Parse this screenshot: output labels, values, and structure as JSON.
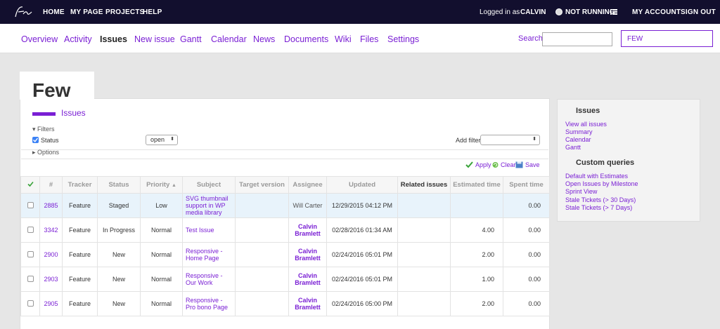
{
  "topbar": {
    "nav": [
      "HOME",
      "MY PAGE",
      "PROJECTS",
      "HELP"
    ],
    "logged_in_as": "Logged in as",
    "user": "CALVIN",
    "timer_status": "NOT RUNNING",
    "my_account": "MY ACCOUNT",
    "sign_out": "SIGN OUT"
  },
  "menu": {
    "tabs": [
      "Overview",
      "Activity",
      "Issues",
      "New issue",
      "Gantt",
      "Calendar",
      "News",
      "Documents",
      "Wiki",
      "Files",
      "Settings"
    ],
    "active_tab": "Issues",
    "search_label": "Search",
    "search_value": "",
    "project_jump": "FEW"
  },
  "page": {
    "project_title": "Few",
    "section": "Issues"
  },
  "filters": {
    "filters_label": "Filters",
    "status_label": "Status",
    "status_operator": "open",
    "add_filter_label": "Add filter",
    "add_filter_value": "",
    "options_label": "Options",
    "apply": "Apply",
    "clear": "Clear",
    "save": "Save"
  },
  "table": {
    "columns": [
      "#",
      "Tracker",
      "Status",
      "Priority",
      "Subject",
      "Target version",
      "Assignee",
      "Updated",
      "Related issues",
      "Estimated time",
      "Spent time"
    ],
    "sort_indicator": "▲",
    "rows": [
      {
        "id": "2885",
        "tracker": "Feature",
        "status": "Staged",
        "priority": "Low",
        "subject": "SVG thumbnail support in WP media library",
        "target_version": "",
        "assignee": "Will Carter",
        "updated": "12/29/2015 04:12 PM",
        "related": "",
        "estimated": "",
        "spent": "0.00"
      },
      {
        "id": "3342",
        "tracker": "Feature",
        "status": "In Progress",
        "priority": "Normal",
        "subject": "Test Issue",
        "target_version": "",
        "assignee": "Calvin Bramlett",
        "updated": "02/28/2016 01:34 AM",
        "related": "",
        "estimated": "4.00",
        "spent": "0.00"
      },
      {
        "id": "2900",
        "tracker": "Feature",
        "status": "New",
        "priority": "Normal",
        "subject": "Responsive - Home Page",
        "target_version": "",
        "assignee": "Calvin Bramlett",
        "updated": "02/24/2016 05:01 PM",
        "related": "",
        "estimated": "2.00",
        "spent": "0.00"
      },
      {
        "id": "2903",
        "tracker": "Feature",
        "status": "New",
        "priority": "Normal",
        "subject": "Responsive - Our Work",
        "target_version": "",
        "assignee": "Calvin Bramlett",
        "updated": "02/24/2016 05:01 PM",
        "related": "",
        "estimated": "1.00",
        "spent": "0.00"
      },
      {
        "id": "2905",
        "tracker": "Feature",
        "status": "New",
        "priority": "Normal",
        "subject": "Responsive - Pro bono Page",
        "target_version": "",
        "assignee": "Calvin Bramlett",
        "updated": "02/24/2016 05:00 PM",
        "related": "",
        "estimated": "2.00",
        "spent": "0.00"
      }
    ]
  },
  "sidebar": {
    "issues_title": "Issues",
    "issues_links": [
      "View all issues",
      "Summary",
      "Calendar",
      "Gantt"
    ],
    "queries_title": "Custom queries",
    "queries_links": [
      "Default with Estimates",
      "Open Issues by Milestone",
      "Sprint View",
      "Stale Tickets (> 30 Days)",
      "Stale Tickets (> 7 Days)"
    ]
  },
  "colors": {
    "accent": "#7a1fd4",
    "topbar_bg": "#120f2e",
    "selected_row": "#e8f3fb"
  }
}
